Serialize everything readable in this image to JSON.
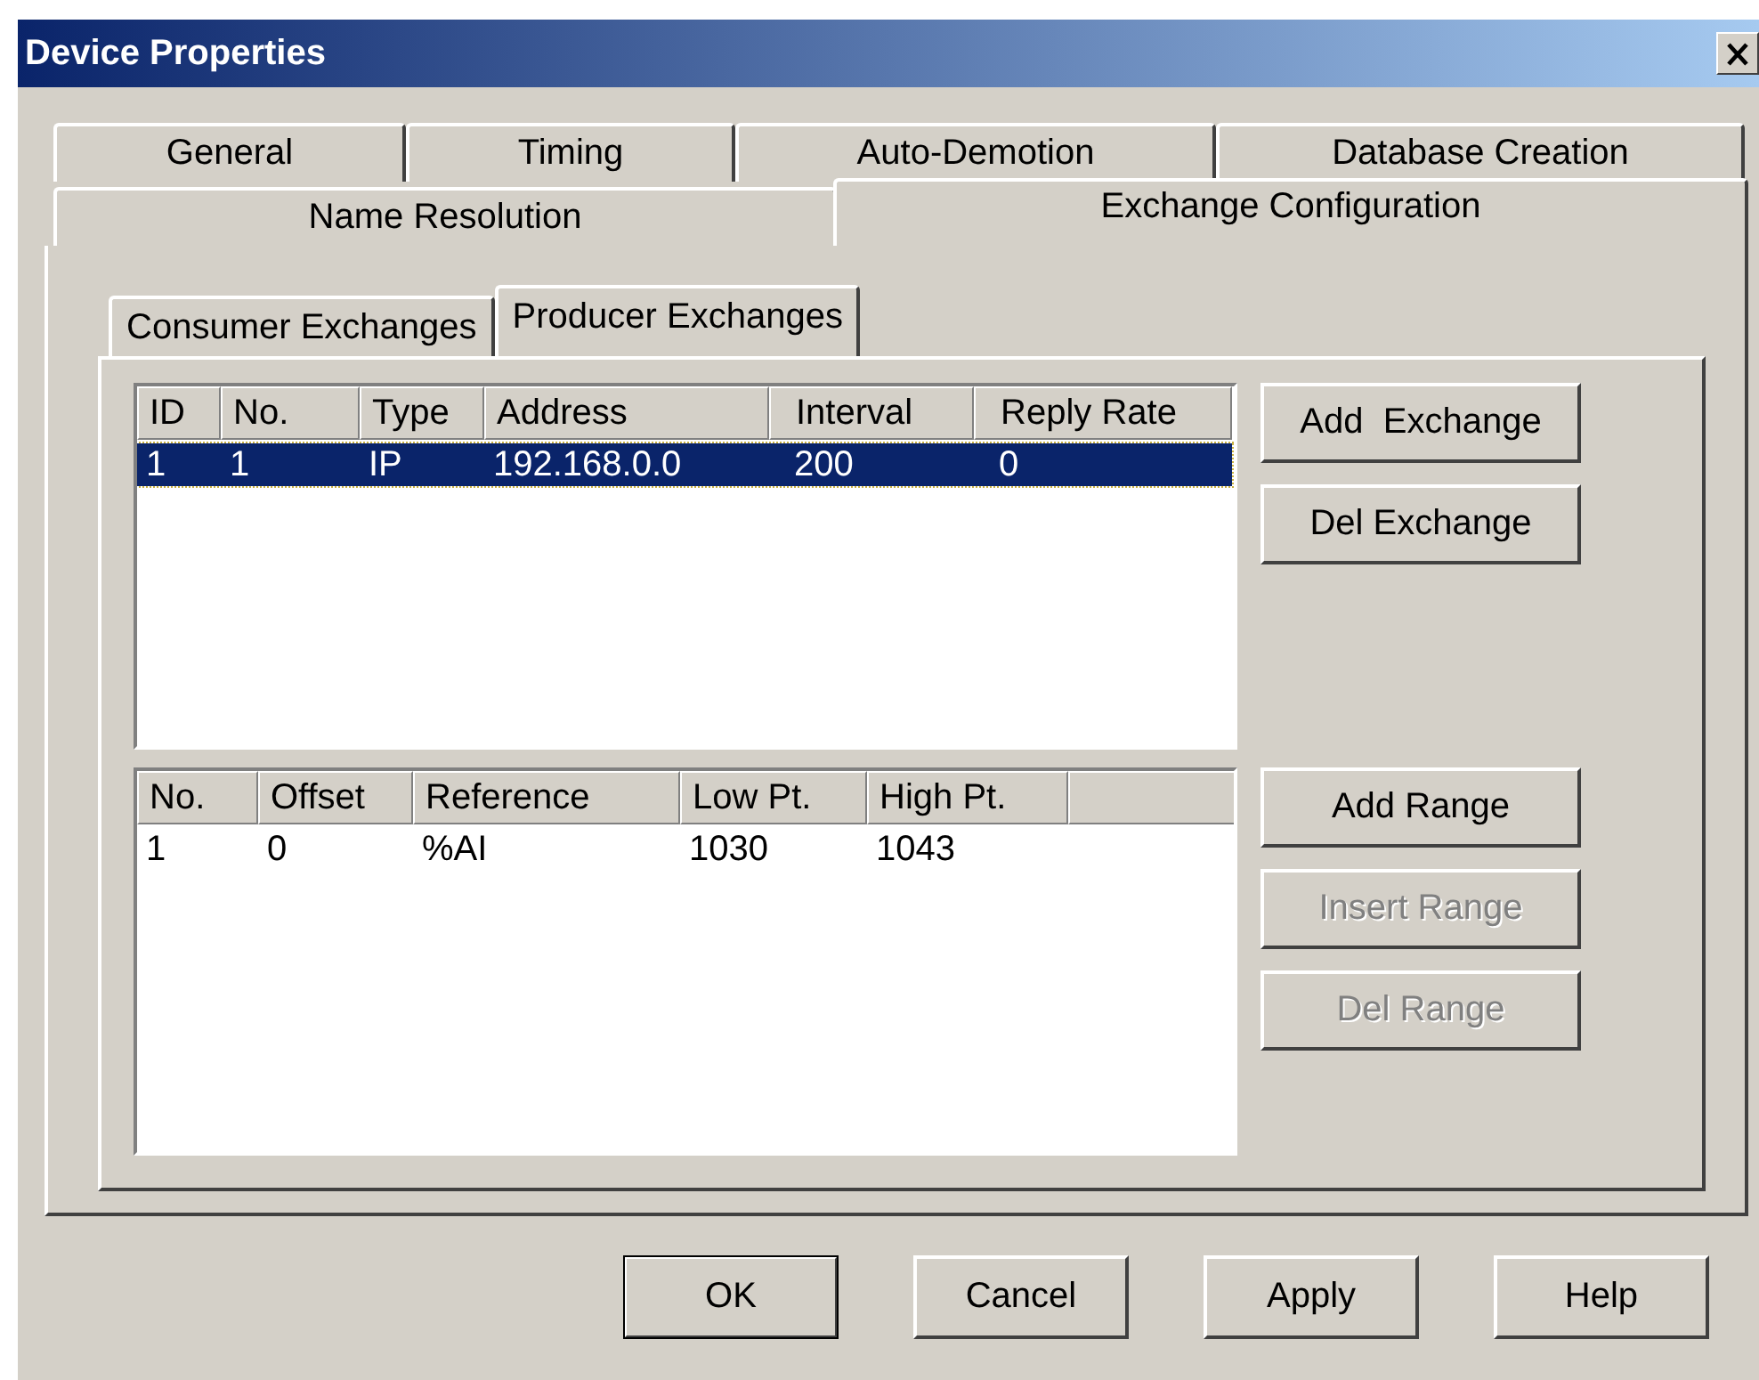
{
  "window": {
    "title": "Device Properties"
  },
  "tab_rows": [
    [
      {
        "label": "General",
        "selected": false
      },
      {
        "label": "Timing",
        "selected": false
      },
      {
        "label": "Auto-Demotion",
        "selected": false
      },
      {
        "label": "Database Creation",
        "selected": false
      }
    ],
    [
      {
        "label": "Name Resolution",
        "selected": false
      },
      {
        "label": "Exchange Configuration",
        "selected": true
      }
    ]
  ],
  "sub_tabs": [
    {
      "label": "Consumer Exchanges",
      "selected": false
    },
    {
      "label": "Producer Exchanges",
      "selected": true
    }
  ],
  "exchanges_table": {
    "columns": [
      "ID",
      "No.",
      "Type",
      "Address",
      "Interval",
      "Reply Rate"
    ],
    "rows": [
      {
        "cells": [
          "1",
          "1",
          "IP",
          "192.168.0.0",
          "200",
          "0"
        ],
        "selected": true
      }
    ]
  },
  "exchange_buttons": [
    {
      "label": "Add  Exchange",
      "disabled": false
    },
    {
      "label": "Del Exchange",
      "disabled": false
    }
  ],
  "ranges_table": {
    "columns": [
      "No.",
      "Offset",
      "Reference",
      "Low Pt.",
      "High Pt."
    ],
    "rows": [
      {
        "cells": [
          "1",
          "0",
          "%AI",
          "1030",
          "1043"
        ],
        "selected": false
      }
    ]
  },
  "range_buttons": [
    {
      "label": "Add Range",
      "disabled": false
    },
    {
      "label": "Insert Range",
      "disabled": true
    },
    {
      "label": "Del Range",
      "disabled": true
    }
  ],
  "dialog_buttons": [
    {
      "label": "OK",
      "default": true
    },
    {
      "label": "Cancel",
      "default": false
    },
    {
      "label": "Apply",
      "default": false
    },
    {
      "label": "Help",
      "default": false
    }
  ]
}
